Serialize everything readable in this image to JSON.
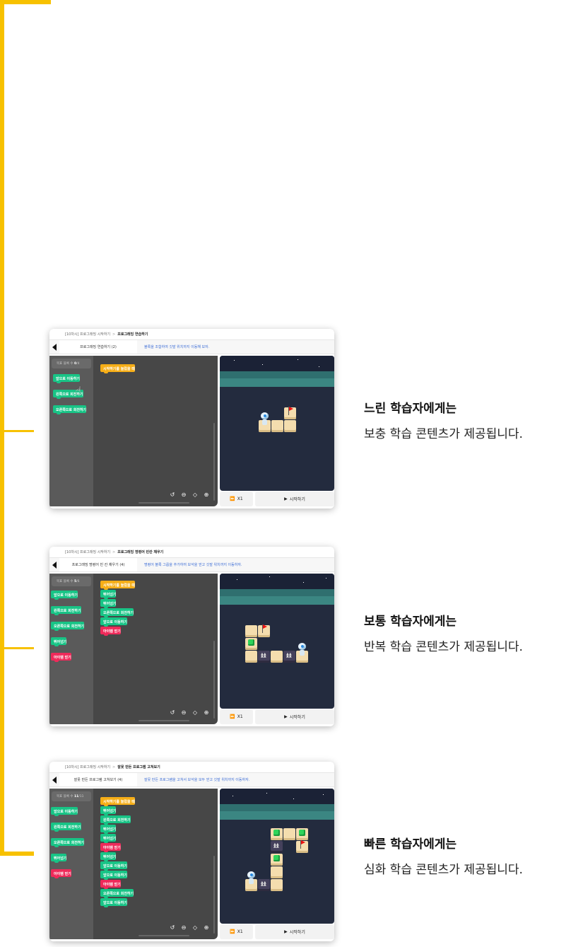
{
  "sections": [
    {
      "card": {
        "breadcrumb_parent": "[10차시] 프로그래밍 시작하기",
        "breadcrumb_current": "프로그래밍 연습하기",
        "tab_title": "프로그래밍 연습하기 (2)",
        "mission": "블록을 조합하여 깃발 위치까지 이동해 보자.",
        "block_count_label": "목표 블록 수",
        "block_count_value": "0",
        "block_count_total": "/4",
        "palette": [
          "앞으로 이동하기",
          "왼쪽으로 회전하기",
          "오른쪽으로 회전하기"
        ],
        "workspace": [
          "시작하기를 눌렀을 때"
        ],
        "speed_label": "X1",
        "start_label": "시작하기"
      },
      "caption_title": "느린 학습자에게는",
      "caption_body": "보충 학습 콘텐츠가 제공됩니다."
    },
    {
      "card": {
        "breadcrumb_parent": "[10차시] 프로그래밍 시작하기",
        "breadcrumb_current": "프로그래밍 명령어 빈칸 채우기",
        "tab_title": "프로그래밍 명령어 빈 칸 채우기 (4)",
        "mission": "명령어 블록 그룹을 추가하여 보석을 얻고 깃발 위치까지 이동하자.",
        "block_count_label": "목표 블록 수",
        "block_count_value": "5",
        "block_count_total": "/6",
        "palette": [
          "앞으로 이동하기",
          "왼쪽으로 회전하기",
          "오른쪽으로 회전하기",
          "뛰어넘기",
          "아이템 얻기"
        ],
        "workspace": [
          "시작하기를 눌렀을 때",
          "뛰어넘기",
          "뛰어넘기",
          "오른쪽으로 회전하기",
          "앞으로 이동하기",
          "아이템 얻기"
        ],
        "speed_label": "X1",
        "start_label": "시작하기"
      },
      "caption_title": "보통 학습자에게는",
      "caption_body": "반복 학습 콘텐츠가 제공됩니다."
    },
    {
      "card": {
        "breadcrumb_parent": "[10차시] 프로그래밍 시작하기",
        "breadcrumb_current": "잘못 만든 프로그램 고쳐보기",
        "tab_title": "잘못 만든 프로그램 고쳐보기 (4)",
        "mission": "잘못 만든 프로그램을 고쳐서 보석을 모두 얻고 깃발 위치까지 이동하자.",
        "block_count_label": "목표 블록 수",
        "block_count_value": "11",
        "block_count_total": "/11",
        "palette": [
          "앞으로 이동하기",
          "왼쪽으로 회전하기",
          "오른쪽으로 회전하기",
          "뛰어넘기",
          "아이템 얻기"
        ],
        "workspace": [
          "시작하기를 눌렀을 때",
          "뛰어넘기",
          "왼쪽으로 회전하기",
          "뛰어넘기",
          "뛰어넘기",
          "아이템 얻기",
          "뛰어넘기",
          "앞으로 이동하기",
          "앞으로 이동하기",
          "아이템 얻기",
          "오른쪽으로 회전하기",
          "앞으로 이동하기"
        ],
        "speed_label": "X1",
        "start_label": "시작하기"
      },
      "caption_title": "빠른 학습자에게는",
      "caption_body": "심화 학습 콘텐츠가 제공됩니다."
    }
  ],
  "colors": {
    "accent": "#f7c100",
    "move_block": "#18c486",
    "event_block": "#f6ae17",
    "item_block": "#ef2a5a",
    "mission_text": "#3f6fd6"
  },
  "icons": [
    "back-arrow-icon",
    "hand-cursor-icon",
    "reset-icon",
    "zoom-out-icon",
    "center-icon",
    "zoom-in-icon",
    "fast-forward-icon",
    "play-icon",
    "flag-icon",
    "gem-icon",
    "robot-icon"
  ]
}
